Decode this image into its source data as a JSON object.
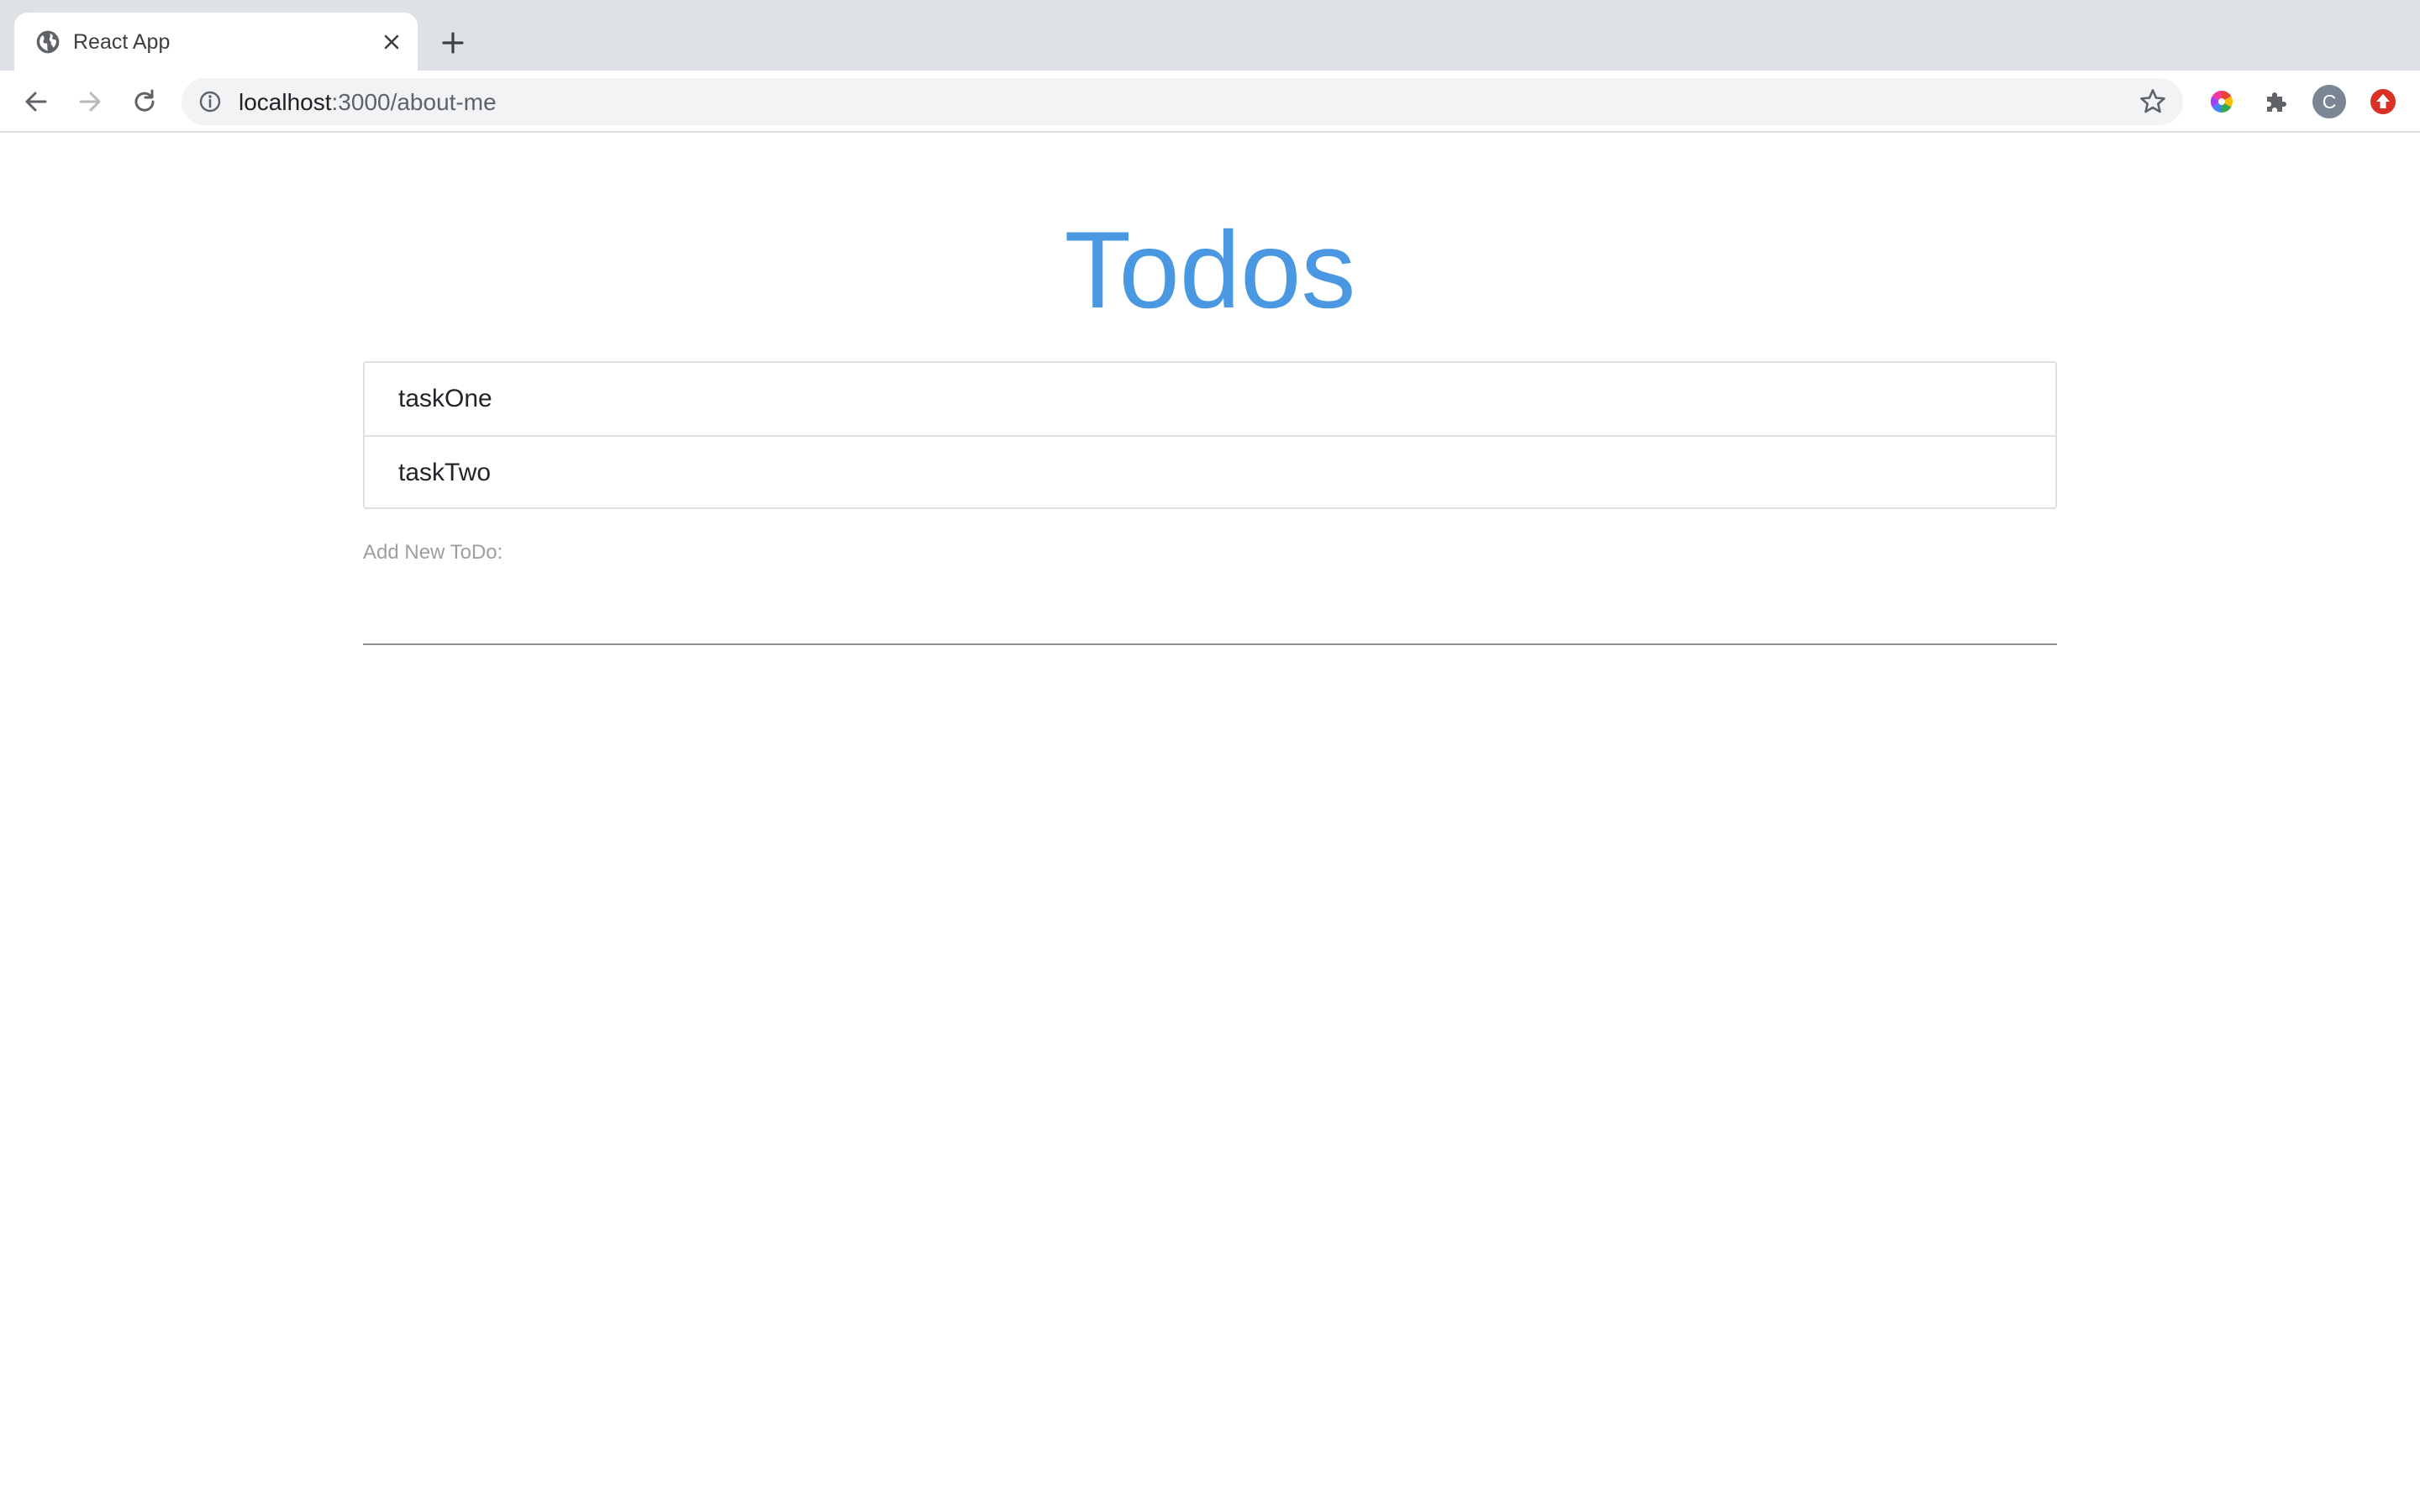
{
  "browser": {
    "tab": {
      "title": "React App",
      "favicon": "globe-icon"
    },
    "url": {
      "host": "localhost",
      "path": ":3000/about-me"
    },
    "profile_initial": "C",
    "colors": {
      "tabstrip": "#dee1e6",
      "omnibox": "#f1f3f4",
      "avatar": "#7a8694",
      "update_badge": "#d93025"
    }
  },
  "app": {
    "title": "Todos",
    "title_color": "#4a98e2",
    "todos": [
      {
        "text": "taskOne"
      },
      {
        "text": "taskTwo"
      }
    ],
    "new_todo": {
      "label": "Add New ToDo:",
      "value": ""
    }
  }
}
